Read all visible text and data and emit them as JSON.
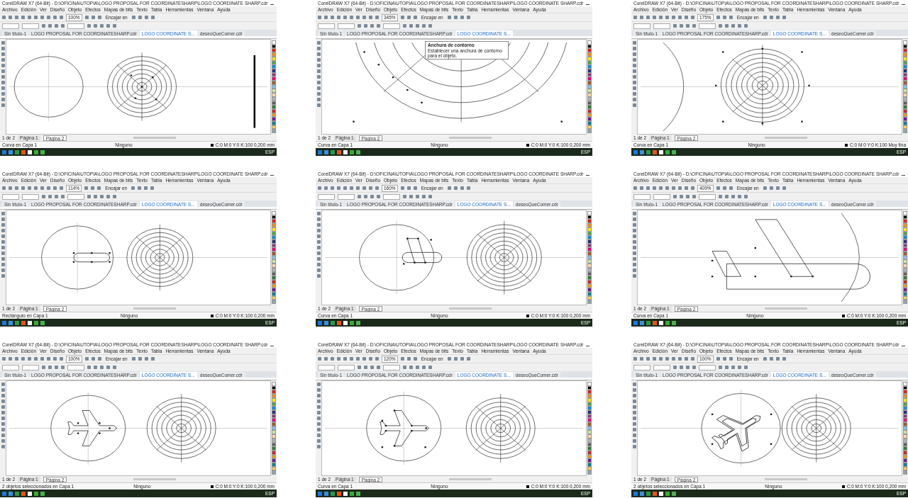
{
  "panels": [
    {
      "title": "CorelDRAW X7 (64-Bit) - D:\\OFICINA\\UTOPIA\\LOGO PROPOSAL FOR COORDINATESHARP\\LOGO COORDINATE SHARP.cdr",
      "menus": [
        "Archivo",
        "Edición",
        "Ver",
        "Diseño",
        "Objeto",
        "Efectos",
        "Mapas de bits",
        "Texto",
        "Tabla",
        "Herramientas",
        "Ventana",
        "Ayuda"
      ],
      "zoom": "100%",
      "snap": "Encajar en",
      "tabs": [
        {
          "label": "Sin título-1",
          "selected": false
        },
        {
          "label": "LOGO PROPOSAL FOR COORDINATESHARP.cdr",
          "selected": false
        },
        {
          "label": "LOGO COORDINATE S...",
          "selected": true
        },
        {
          "label": "deseoQueComer.cdr",
          "selected": false
        }
      ],
      "page_count": "1 de 2",
      "page_tabs": [
        {
          "label": "Página 1",
          "selected": false
        },
        {
          "label": "Página 2",
          "selected": true
        }
      ],
      "status": "Curva en Capa 1",
      "fill": "Ninguno",
      "outline": "C:0 M:0 Y:0 K:100 0,200 mm",
      "lang": "ESP",
      "kind": "overview"
    },
    {
      "title": "CorelDRAW X7 (64-Bit) - D:\\OFICINA\\UTOPIA\\LOGO PROPOSAL FOR COORDINATESHARP\\LOGO COORDINATE SHARP.cdr",
      "menus": [
        "Archivo",
        "Edición",
        "Ver",
        "Diseño",
        "Objeto",
        "Efectos",
        "Mapas de bits",
        "Texto",
        "Tabla",
        "Herramientas",
        "Ventana",
        "Ayuda"
      ],
      "zoom": "345%",
      "snap": "Encajar en",
      "tabs": [
        {
          "label": "Sin título-1",
          "selected": false
        },
        {
          "label": "LOGO PROPOSAL FOR COORDINATESHARP.cdr",
          "selected": false
        },
        {
          "label": "LOGO COORDINATE S...",
          "selected": true
        }
      ],
      "tooltip": {
        "heading": "Anchura de contorno",
        "text": "Establecer una anchura de contorno para el objeto."
      },
      "page_count": "1 de 2",
      "page_tabs": [
        {
          "label": "Página 1",
          "selected": false
        },
        {
          "label": "Página 2",
          "selected": true
        }
      ],
      "status": "Curva en Capa 1",
      "fill": "Ninguno",
      "outline": "C:0 M:0 Y:0 K:100 0,200 mm",
      "lang": "ESP",
      "kind": "closeup"
    },
    {
      "title": "CorelDRAW X7 (64-Bit) - D:\\OFICINA\\UTOPIA\\LOGO PROPOSAL FOR COORDINATESHARP\\LOGO COORDINATE SHARP.cdr",
      "menus": [
        "Archivo",
        "Edición",
        "Ver",
        "Diseño",
        "Objeto",
        "Efectos",
        "Mapas de bits",
        "Texto",
        "Tabla",
        "Herramientas",
        "Ventana",
        "Ayuda"
      ],
      "zoom": "175%",
      "snap": "Encajar en",
      "tabs": [
        {
          "label": "Sin título-1",
          "selected": false
        },
        {
          "label": "LOGO PROPOSAL FOR COORDINATESHARP.cdr",
          "selected": false
        },
        {
          "label": "LOGO COORDINATE S...",
          "selected": true
        },
        {
          "label": "deseoQueComer.cdr",
          "selected": false
        }
      ],
      "page_count": "1 de 2",
      "page_tabs": [
        {
          "label": "Página 1",
          "selected": false
        },
        {
          "label": "Página 2",
          "selected": true
        }
      ],
      "status": "Curva en Capa 1",
      "fill": "Ninguno",
      "outline": "C:0 M:0 Y:0 K:100 Muy fina",
      "lang": "ESP",
      "kind": "centered"
    },
    {
      "title": "CorelDRAW X7 (64-Bit) - D:\\OFICINA\\UTOPIA\\LOGO PROPOSAL FOR COORDINATESHARP\\LOGO COORDINATE SHARP.cdr",
      "menus": [
        "Archivo",
        "Edición",
        "Ver",
        "Diseño",
        "Objeto",
        "Efectos",
        "Mapas de bits",
        "Texto",
        "Tabla",
        "Herramientas",
        "Ventana",
        "Ayuda"
      ],
      "zoom": "114%",
      "snap": "Encajar en",
      "tabs": [
        {
          "label": "Sin título-1",
          "selected": false
        },
        {
          "label": "LOGO PROPOSAL FOR COORDINATESHARP.cdr",
          "selected": false
        },
        {
          "label": "LOGO COORDINATE S...",
          "selected": true
        },
        {
          "label": "deseoQueComer.cdr",
          "selected": false
        }
      ],
      "page_count": "1 de 2",
      "page_tabs": [
        {
          "label": "Página 1",
          "selected": false
        },
        {
          "label": "Página 2",
          "selected": true
        }
      ],
      "status": "Rectángulo en Capa 1",
      "fill": "Ninguno",
      "outline": "C:0 M:0 Y:0 K:100 0,200 mm",
      "lang": "ESP",
      "kind": "rect"
    },
    {
      "title": "CorelDRAW X7 (64-Bit) - D:\\OFICINA\\UTOPIA\\LOGO PROPOSAL FOR COORDINATESHARP\\LOGO COORDINATE SHARP.cdr",
      "menus": [
        "Archivo",
        "Edición",
        "Ver",
        "Diseño",
        "Objeto",
        "Efectos",
        "Mapas de bits",
        "Texto",
        "Tabla",
        "Herramientas",
        "Ventana",
        "Ayuda"
      ],
      "zoom": "160%",
      "snap": "Encajar en",
      "tabs": [
        {
          "label": "Sin título-1",
          "selected": false
        },
        {
          "label": "LOGO PROPOSAL FOR COORDINATESHARP.cdr",
          "selected": false
        },
        {
          "label": "LOGO COORDINATE S...",
          "selected": true
        },
        {
          "label": "deseoQueComer.cdr",
          "selected": false
        }
      ],
      "page_count": "1 de 2",
      "page_tabs": [
        {
          "label": "Página 1",
          "selected": false
        },
        {
          "label": "Página 2",
          "selected": true
        }
      ],
      "status": "Curva en Capa 1",
      "fill": "Ninguno",
      "outline": "C:0 M:0 Y:0 K:100 0,200 mm",
      "lang": "ESP",
      "kind": "trapezoid"
    },
    {
      "title": "CorelDRAW X7 (64-Bit) - D:\\OFICINA\\UTOPIA\\LOGO PROPOSAL FOR COORDINATESHARP\\LOGO COORDINATE SHARP.cdr",
      "menus": [
        "Archivo",
        "Edición",
        "Ver",
        "Diseño",
        "Objeto",
        "Efectos",
        "Mapas de bits",
        "Texto",
        "Tabla",
        "Herramientas",
        "Ventana",
        "Ayuda"
      ],
      "zoom": "409%",
      "snap": "Encajar en",
      "tabs": [
        {
          "label": "Sin título-1",
          "selected": false
        },
        {
          "label": "LOGO PROPOSAL FOR COORDINATESHARP.cdr",
          "selected": false
        },
        {
          "label": "LOGO COORDINATE S...",
          "selected": true
        },
        {
          "label": "deseoQueComer.cdr",
          "selected": false
        }
      ],
      "page_count": "1 de 2",
      "page_tabs": [
        {
          "label": "Página 1",
          "selected": false
        },
        {
          "label": "Página 2",
          "selected": true
        }
      ],
      "status": "Curva en Capa 1",
      "fill": "Ninguno",
      "outline": "C:0 M:0 Y:0 K:100 0,200 mm",
      "lang": "ESP",
      "kind": "wing"
    },
    {
      "title": "CorelDRAW X7 (64-Bit) - D:\\OFICINA\\UTOPIA\\LOGO PROPOSAL FOR COORDINATESHARP\\LOGO COORDINATE SHARP.cdr",
      "menus": [
        "Archivo",
        "Edición",
        "Ver",
        "Diseño",
        "Objeto",
        "Efectos",
        "Mapas de bits",
        "Texto",
        "Tabla",
        "Herramientas",
        "Ventana",
        "Ayuda"
      ],
      "zoom": "100%",
      "snap": "Encajar en",
      "tabs": [
        {
          "label": "Sin título-1",
          "selected": false
        },
        {
          "label": "LOGO PROPOSAL FOR COORDINATESHARP.cdr",
          "selected": false
        },
        {
          "label": "LOGO COORDINATE S...",
          "selected": true
        },
        {
          "label": "deseoQueComer.cdr",
          "selected": false
        }
      ],
      "page_count": "1 de 2",
      "page_tabs": [
        {
          "label": "Página 1",
          "selected": false
        },
        {
          "label": "Página 2",
          "selected": true
        }
      ],
      "status": "2 objetos seleccionados en Capa 1",
      "fill": "Ninguno",
      "outline": "C:0 M:0 Y:0 K:100 0,200 mm",
      "lang": "ESP",
      "kind": "plane"
    },
    {
      "title": "CorelDRAW X7 (64-Bit) - D:\\OFICINA\\UTOPIA\\LOGO PROPOSAL FOR COORDINATESHARP\\LOGO COORDINATE SHARP.cdr",
      "menus": [
        "Archivo",
        "Edición",
        "Ver",
        "Diseño",
        "Objeto",
        "Efectos",
        "Mapas de bits",
        "Texto",
        "Tabla",
        "Herramientas",
        "Ventana",
        "Ayuda"
      ],
      "zoom": "120%",
      "snap": "Encajar en",
      "tabs": [
        {
          "label": "Sin título-1",
          "selected": false
        },
        {
          "label": "LOGO PROPOSAL FOR COORDINATESHARP.cdr",
          "selected": false
        },
        {
          "label": "LOGO COORDINATE S...",
          "selected": true
        },
        {
          "label": "deseoQueComer.cdr",
          "selected": false
        }
      ],
      "page_count": "1 de 2",
      "page_tabs": [
        {
          "label": "Página 1",
          "selected": false
        },
        {
          "label": "Página 2",
          "selected": true
        }
      ],
      "status": "Curva en Capa 1",
      "fill": "Ninguno",
      "outline": "C:0 M:0 Y:0 K:100 0,200 mm",
      "lang": "ESP",
      "kind": "plane-nodes"
    },
    {
      "title": "CorelDRAW X7 (64-Bit) - D:\\OFICINA\\UTOPIA\\LOGO PROPOSAL FOR COORDINATESHARP\\LOGO COORDINATE SHARP.cdr",
      "menus": [
        "Archivo",
        "Edición",
        "Ver",
        "Diseño",
        "Objeto",
        "Efectos",
        "Mapas de bits",
        "Texto",
        "Tabla",
        "Herramientas",
        "Ventana",
        "Ayuda"
      ],
      "zoom": "100%",
      "snap": "Encajar en",
      "tabs": [
        {
          "label": "Sin título-1",
          "selected": false
        },
        {
          "label": "LOGO PROPOSAL FOR COORDINATESHARP.cdr",
          "selected": false
        },
        {
          "label": "LOGO COORDINATE S...",
          "selected": true
        },
        {
          "label": "deseoQueComer.cdr",
          "selected": false
        }
      ],
      "page_count": "1 de 2",
      "page_tabs": [
        {
          "label": "Página 1",
          "selected": false
        },
        {
          "label": "Página 2",
          "selected": true
        }
      ],
      "status": "2 objetos seleccionados en Capa 1",
      "fill": "Ninguno",
      "outline": "C:0 M:0 Y:0 K:100 0,200 mm",
      "lang": "ESP",
      "kind": "plane-rounded"
    }
  ]
}
